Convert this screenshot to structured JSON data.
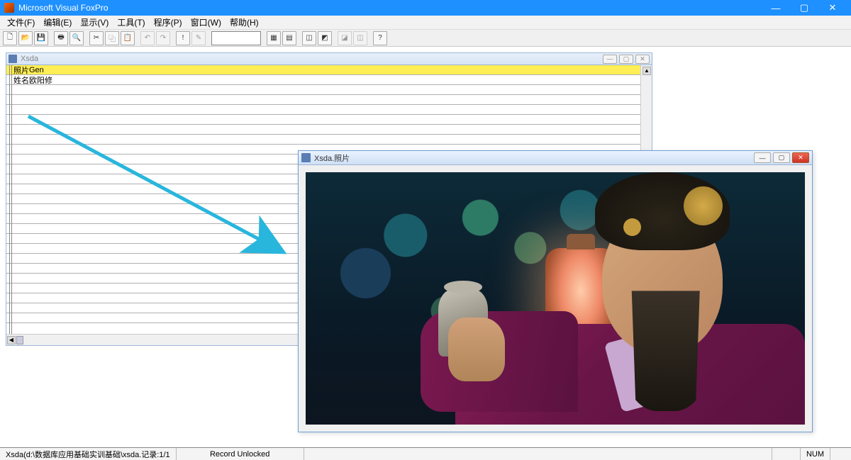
{
  "app": {
    "title": "Microsoft Visual FoxPro"
  },
  "window_controls": {
    "min": "—",
    "max": "▢",
    "close": "✕"
  },
  "menu": [
    "文件(F)",
    "编辑(E)",
    "显示(V)",
    "工具(T)",
    "程序(P)",
    "窗口(W)",
    "帮助(H)"
  ],
  "toolbar_icons": [
    "new",
    "open",
    "save",
    "",
    "print",
    "preview",
    "",
    "cut",
    "copy",
    "paste",
    "",
    "undo",
    "redo",
    "",
    "run",
    "modify",
    "",
    "",
    "",
    "form",
    "report",
    "",
    "db1",
    "db2",
    "",
    "w1",
    "w2",
    "",
    "help"
  ],
  "browse": {
    "title": "Xsda",
    "rows": [
      {
        "label": "照片",
        "value": "Gen",
        "highlight": true
      },
      {
        "label": "姓名",
        "value": "欧阳修",
        "highlight": false
      }
    ],
    "ctrl": {
      "min": "—",
      "max": "▢",
      "close": "✕"
    }
  },
  "photo_window": {
    "title": "Xsda.照片",
    "ctrl": {
      "min": "—",
      "max": "▢",
      "close": "✕"
    }
  },
  "status": {
    "path": "Xsda(d:\\数据库应用基础实训基础\\xsda.记录:1/1",
    "lock": "Record Unlocked",
    "ins": "NUM"
  },
  "colors": {
    "accent": "#1e90ff",
    "highlight": "#ffee55",
    "arrow": "#29b6dd"
  }
}
